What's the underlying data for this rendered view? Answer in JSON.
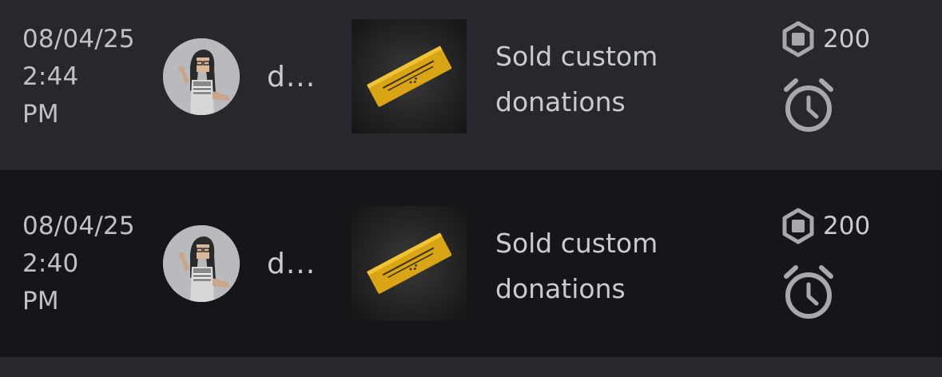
{
  "transactions": [
    {
      "date": "08/04/25",
      "time": "2:44",
      "ampm": "PM",
      "username": "d...",
      "description_line1": "Sold custom",
      "description_line2": "donations",
      "price": "200",
      "currency_icon": "robux-icon",
      "status_icon": "alarm-clock-icon"
    },
    {
      "date": "08/04/25",
      "time": "2:40",
      "ampm": "PM",
      "username": "d...",
      "description_line1": "Sold custom",
      "description_line2": "donations",
      "price": "200",
      "currency_icon": "robux-icon",
      "status_icon": "alarm-clock-icon"
    }
  ],
  "colors": {
    "row_light": "#26282d",
    "row_dark": "#16161a",
    "text": "#c9cbce",
    "icon": "#a6a8ab",
    "ticket_gold": "#d9a514"
  }
}
